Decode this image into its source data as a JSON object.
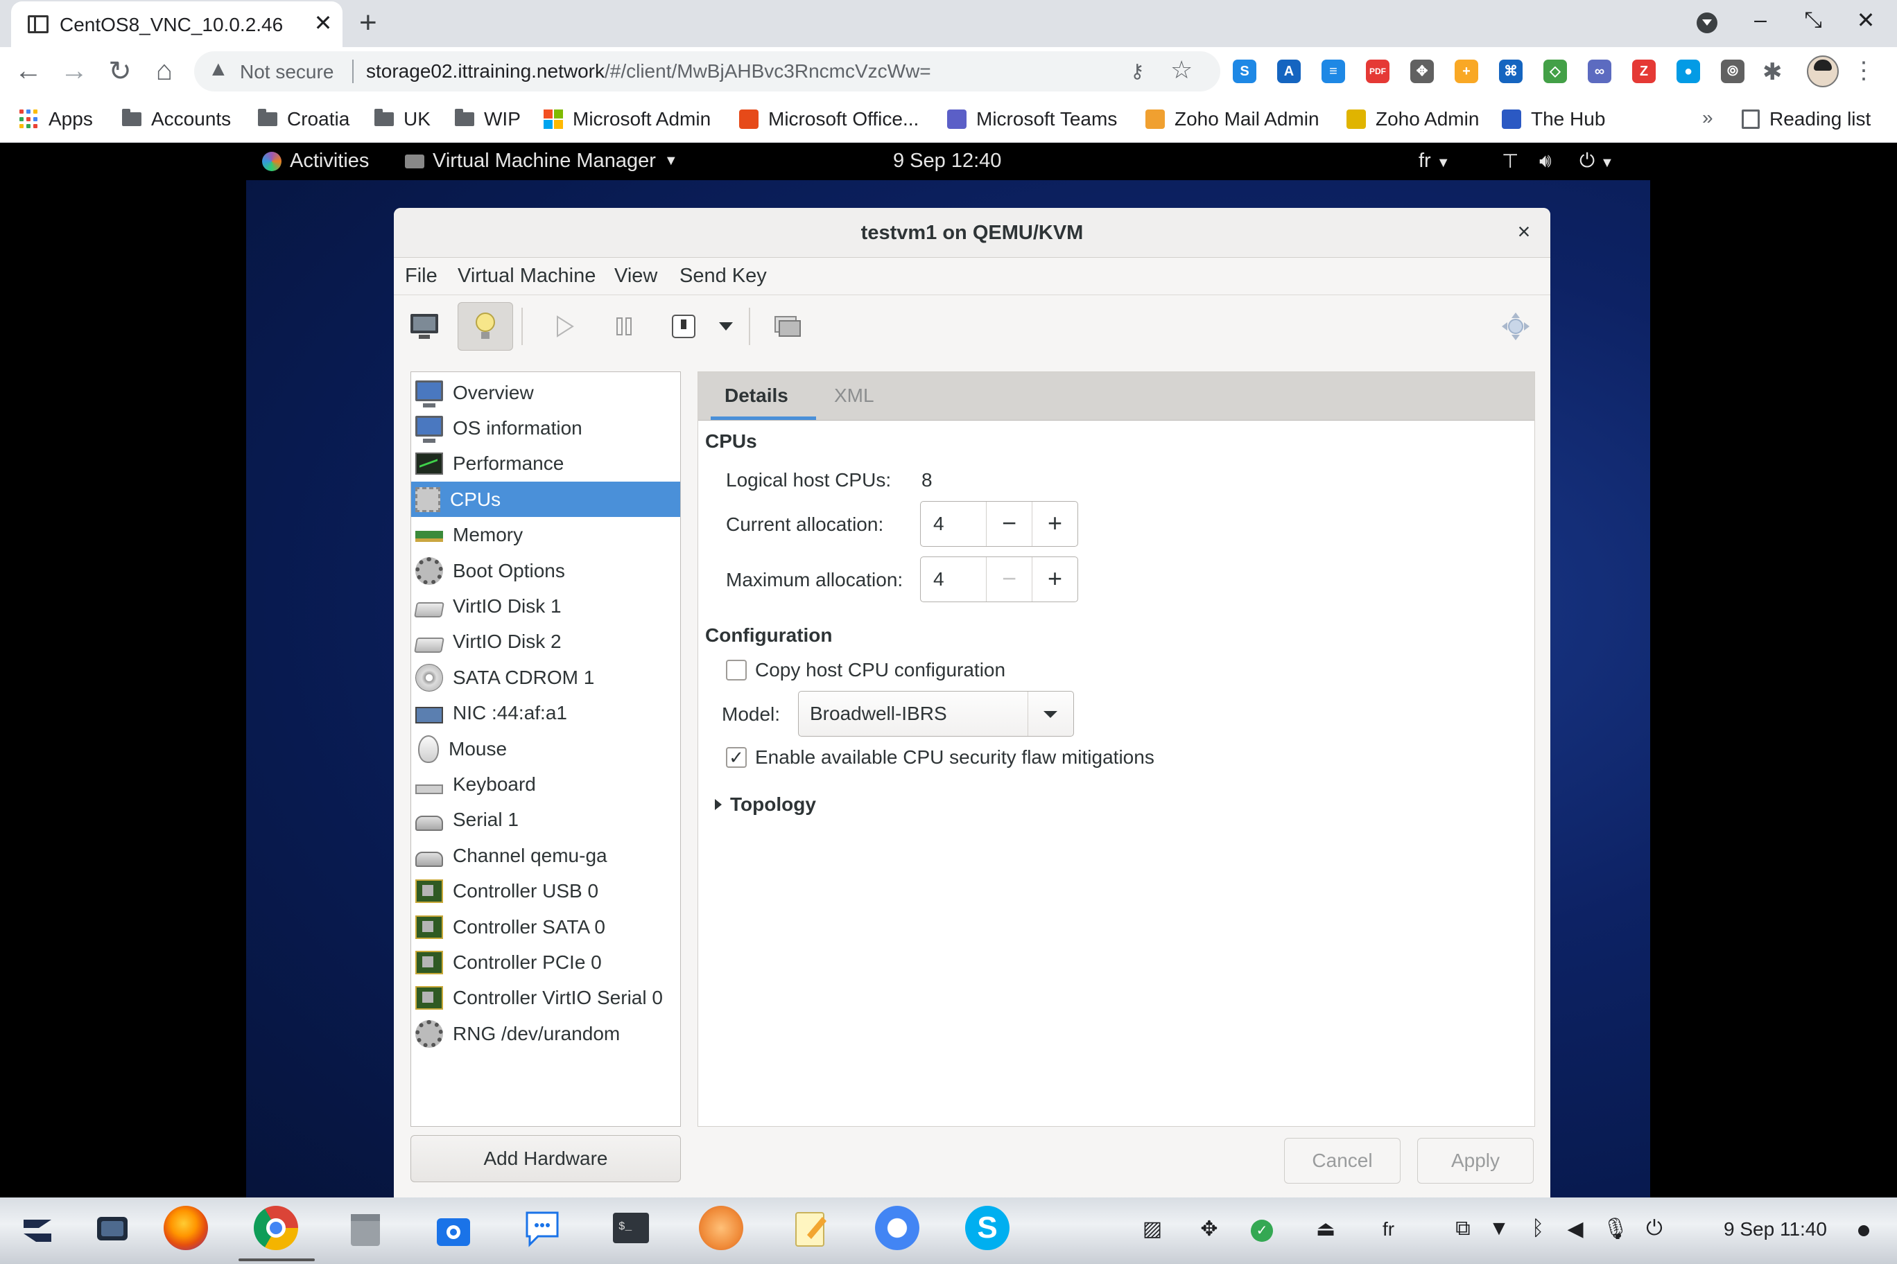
{
  "browser": {
    "tab_title": "CentOS8_VNC_10.0.2.46",
    "tab_close": "✕",
    "new_tab": "+",
    "security_label": "Not secure",
    "url_host": "storage02.ittraining.network",
    "url_path": "/#/client/MwBjAHBvc3RncmcVzcWw=",
    "bookmarks": [
      {
        "label": "Apps",
        "icon": "apps-grid-icon"
      },
      {
        "label": "Accounts",
        "icon": "folder-icon"
      },
      {
        "label": "Croatia",
        "icon": "folder-icon"
      },
      {
        "label": "UK",
        "icon": "folder-icon"
      },
      {
        "label": "WIP",
        "icon": "folder-icon"
      },
      {
        "label": "Microsoft Admin",
        "icon": "microsoft-logo-icon"
      },
      {
        "label": "Microsoft Office...",
        "icon": "office-icon"
      },
      {
        "label": "Microsoft Teams",
        "icon": "teams-icon"
      },
      {
        "label": "Zoho Mail Admin",
        "icon": "zoho-mail-icon"
      },
      {
        "label": "Zoho Admin",
        "icon": "zoho-icon"
      },
      {
        "label": "The Hub",
        "icon": "hub-icon"
      }
    ],
    "bookmarks_overflow": "»",
    "reading_list": "Reading list",
    "extension_colors": [
      "#1e88e5",
      "#1565c0",
      "#1e88e5",
      "#e53935",
      "#616161",
      "#f9a825",
      "#1565c0",
      "#43a047",
      "#5c6bc0",
      "#e53935",
      "#039be5",
      "#616161"
    ]
  },
  "gnome": {
    "activities": "Activities",
    "app_menu": "Virtual Machine Manager",
    "clock": "9 Sep  12:40",
    "keyboard_layout": "fr"
  },
  "vmwindow": {
    "title": "testvm1 on QEMU/KVM",
    "close": "×",
    "menus": [
      "File",
      "Virtual Machine",
      "View",
      "Send Key"
    ],
    "hardware": [
      {
        "label": "Overview",
        "icon": "monitor-icon"
      },
      {
        "label": "OS information",
        "icon": "monitor-icon"
      },
      {
        "label": "Performance",
        "icon": "performance-icon"
      },
      {
        "label": "CPUs",
        "icon": "cpu-icon",
        "selected": true
      },
      {
        "label": "Memory",
        "icon": "memory-icon"
      },
      {
        "label": "Boot Options",
        "icon": "gears-icon"
      },
      {
        "label": "VirtIO Disk 1",
        "icon": "disk-icon"
      },
      {
        "label": "VirtIO Disk 2",
        "icon": "disk-icon"
      },
      {
        "label": "SATA CDROM 1",
        "icon": "cdrom-icon"
      },
      {
        "label": "NIC :44:af:a1",
        "icon": "nic-icon"
      },
      {
        "label": "Mouse",
        "icon": "mouse-icon"
      },
      {
        "label": "Keyboard",
        "icon": "keyboard-icon"
      },
      {
        "label": "Serial 1",
        "icon": "serial-icon"
      },
      {
        "label": "Channel qemu-ga",
        "icon": "serial-icon"
      },
      {
        "label": "Controller USB 0",
        "icon": "controller-icon"
      },
      {
        "label": "Controller SATA 0",
        "icon": "controller-icon"
      },
      {
        "label": "Controller PCIe 0",
        "icon": "controller-icon"
      },
      {
        "label": "Controller VirtIO Serial 0",
        "icon": "controller-icon"
      },
      {
        "label": "RNG /dev/urandom",
        "icon": "gears-icon"
      }
    ],
    "add_hardware": "Add Hardware",
    "tabs": {
      "details": "Details",
      "xml": "XML"
    },
    "cpus": {
      "heading": "CPUs",
      "logical_label": "Logical host CPUs:",
      "logical_value": "8",
      "current_label": "Current allocation:",
      "current_value": "4",
      "max_label": "Maximum allocation:",
      "max_value": "4",
      "minus": "−",
      "plus": "+"
    },
    "configuration": {
      "heading": "Configuration",
      "copy_host_label": "Copy host CPU configuration",
      "copy_host_checked": false,
      "model_label": "Model:",
      "model_value": "Broadwell-IBRS",
      "mitigations_label": "Enable available CPU security flaw mitigations",
      "mitigations_checked": true,
      "checkmark": "✓"
    },
    "topology": "Topology",
    "cancel": "Cancel",
    "apply": "Apply"
  },
  "shelf": {
    "keyboard_layout": "fr",
    "date_time": "9 Sep  11:40"
  }
}
